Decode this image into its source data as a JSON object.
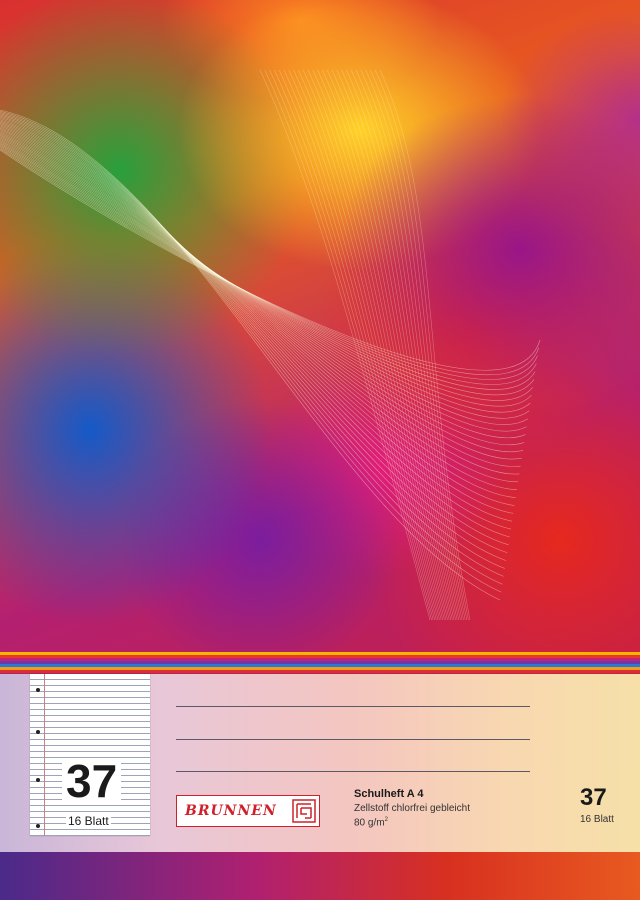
{
  "cover": {
    "number": "37",
    "sheets": "16 Blatt",
    "brand": "BRUNNEN",
    "brand_mark": "brunnen-logo-mark",
    "product_title": "Schulheft A 4",
    "paper_description": "Zellstoff chlorfrei gebleicht",
    "paper_weight": "80 g/m",
    "paper_weight_unit_sup": "2",
    "right_number": "37",
    "right_sheets": "16 Blatt"
  },
  "colors": {
    "brand_red": "#d0202a",
    "stripes": [
      "#f7b500",
      "#e53a2a",
      "#c81e78",
      "#6a3aa8",
      "#2a7ad0",
      "#f29a1a",
      "#d83030"
    ]
  }
}
